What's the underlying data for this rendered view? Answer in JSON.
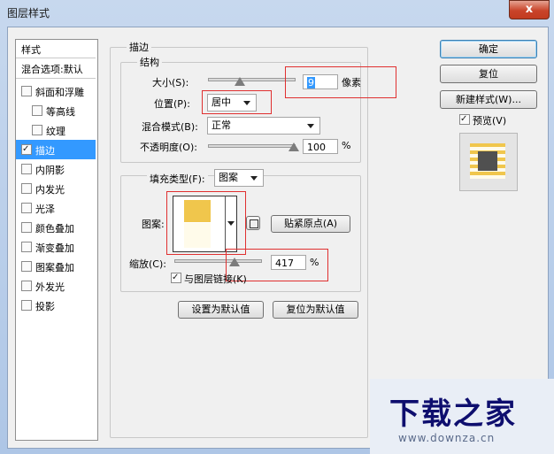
{
  "window": {
    "title": "图层样式",
    "close_glyph": "x"
  },
  "sidebar": {
    "header": "样式",
    "blend_options": "混合选项:默认",
    "items": [
      {
        "label": "斜面和浮雕",
        "checked": false,
        "indent": false
      },
      {
        "label": "等高线",
        "checked": false,
        "indent": true
      },
      {
        "label": "纹理",
        "checked": false,
        "indent": true
      },
      {
        "label": "描边",
        "checked": true,
        "indent": false,
        "selected": true
      },
      {
        "label": "内阴影",
        "checked": false,
        "indent": false
      },
      {
        "label": "内发光",
        "checked": false,
        "indent": false
      },
      {
        "label": "光泽",
        "checked": false,
        "indent": false
      },
      {
        "label": "颜色叠加",
        "checked": false,
        "indent": false
      },
      {
        "label": "渐变叠加",
        "checked": false,
        "indent": false
      },
      {
        "label": "图案叠加",
        "checked": false,
        "indent": false
      },
      {
        "label": "外发光",
        "checked": false,
        "indent": false
      },
      {
        "label": "投影",
        "checked": false,
        "indent": false
      }
    ]
  },
  "stroke": {
    "group_title": "描边",
    "structure_title": "结构",
    "size_label": "大小(S):",
    "size_value": "9",
    "size_unit": "像素",
    "position_label": "位置(P):",
    "position_value": "居中",
    "blend_label": "混合模式(B):",
    "blend_value": "正常",
    "opacity_label": "不透明度(O):",
    "opacity_value": "100",
    "opacity_unit": "%",
    "fill_type_label": "填充类型(F):",
    "fill_type_value": "图案",
    "pattern_label": "图案:",
    "snap_origin_label": "贴紧原点(A)",
    "scale_label": "缩放(C):",
    "scale_value": "417",
    "scale_unit": "%",
    "link_label": "与图层链接(K)",
    "link_checked": true,
    "default_set_label": "设置为默认值",
    "default_reset_label": "复位为默认值"
  },
  "buttons": {
    "ok": "确定",
    "reset": "复位",
    "new_style": "新建样式(W)...",
    "preview_label": "预览(V)",
    "preview_checked": true
  },
  "watermark": {
    "big": "下载之家",
    "small": "www.downza.cn"
  },
  "colors": {
    "selection": "#3399ff",
    "red_highlight": "#e03030",
    "pattern_yellow": "#f0c64c",
    "pattern_cream": "#fffbea",
    "watermark_text": "#0e0e6e"
  }
}
